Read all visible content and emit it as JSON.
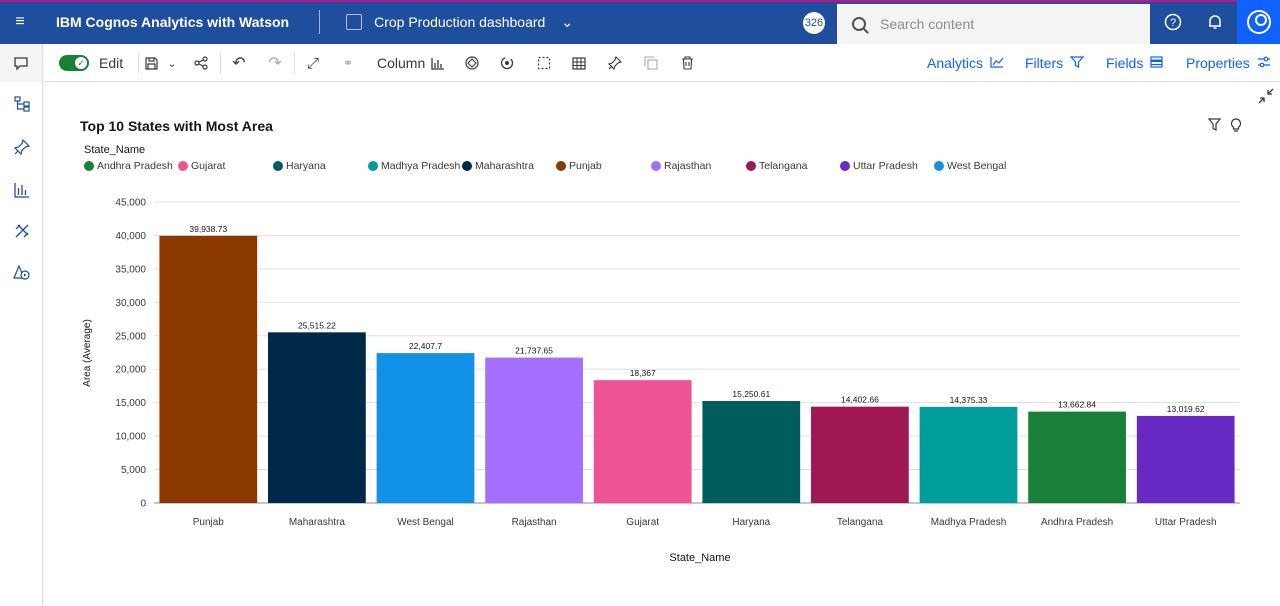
{
  "topbar": {
    "app_name": "IBM Cognos Analytics with Watson",
    "dashboard_title": "Crop Production dashboard",
    "badge_count": "326",
    "search_placeholder": "Search content"
  },
  "toolbar": {
    "edit_label": "Edit",
    "column_label": "Column",
    "analytics_label": "Analytics",
    "filters_label": "Filters",
    "fields_label": "Fields",
    "properties_label": "Properties"
  },
  "colors": {
    "topbar": "#1f4f9c",
    "accent": "#0f62fe",
    "edit_toggle": "#198038"
  },
  "widget": {
    "title": "Top 10 States with Most Area",
    "legend_title": "State_Name"
  },
  "legend": [
    {
      "label": "Andhra Pradesh",
      "color": "#198038"
    },
    {
      "label": "Gujarat",
      "color": "#ee5396"
    },
    {
      "label": "Haryana",
      "color": "#005d5d"
    },
    {
      "label": "Madhya Pradesh",
      "color": "#009d9a"
    },
    {
      "label": "Maharashtra",
      "color": "#012749"
    },
    {
      "label": "Punjab",
      "color": "#8a3800"
    },
    {
      "label": "Rajasthan",
      "color": "#a56eff"
    },
    {
      "label": "Telangana",
      "color": "#9f1853"
    },
    {
      "label": "Uttar Pradesh",
      "color": "#6929c4"
    },
    {
      "label": "West Bengal",
      "color": "#1192e8"
    }
  ],
  "chart_data": {
    "type": "bar",
    "title": "Top 10 States with Most Area",
    "xlabel": "State_Name",
    "ylabel": "Area (Average)",
    "ylim": [
      0,
      45000
    ],
    "y_ticks": [
      "0",
      "5,000",
      "10,000",
      "15,000",
      "20,000",
      "25,000",
      "30,000",
      "35,000",
      "40,000",
      "45,000"
    ],
    "categories": [
      "Punjab",
      "Maharashtra",
      "West Bengal",
      "Rajasthan",
      "Gujarat",
      "Haryana",
      "Telangana",
      "Madhya Pradesh",
      "Andhra Pradesh",
      "Uttar Pradesh"
    ],
    "values": [
      39938.73,
      25515.22,
      22407.7,
      21737.65,
      18367,
      15250.61,
      14402.66,
      14375.33,
      13662.84,
      13019.62
    ],
    "value_labels": [
      "39,938.73",
      "25,515.22",
      "22,407.7",
      "21,737.65",
      "18,367",
      "15,250.61",
      "14,402.66",
      "14,375.33",
      "13,662.84",
      "13,019.62"
    ],
    "colors": [
      "#8a3800",
      "#012749",
      "#1192e8",
      "#a56eff",
      "#ee5396",
      "#005d5d",
      "#9f1853",
      "#009d9a",
      "#198038",
      "#6929c4"
    ],
    "grid": true,
    "legend_position": "top-left"
  }
}
